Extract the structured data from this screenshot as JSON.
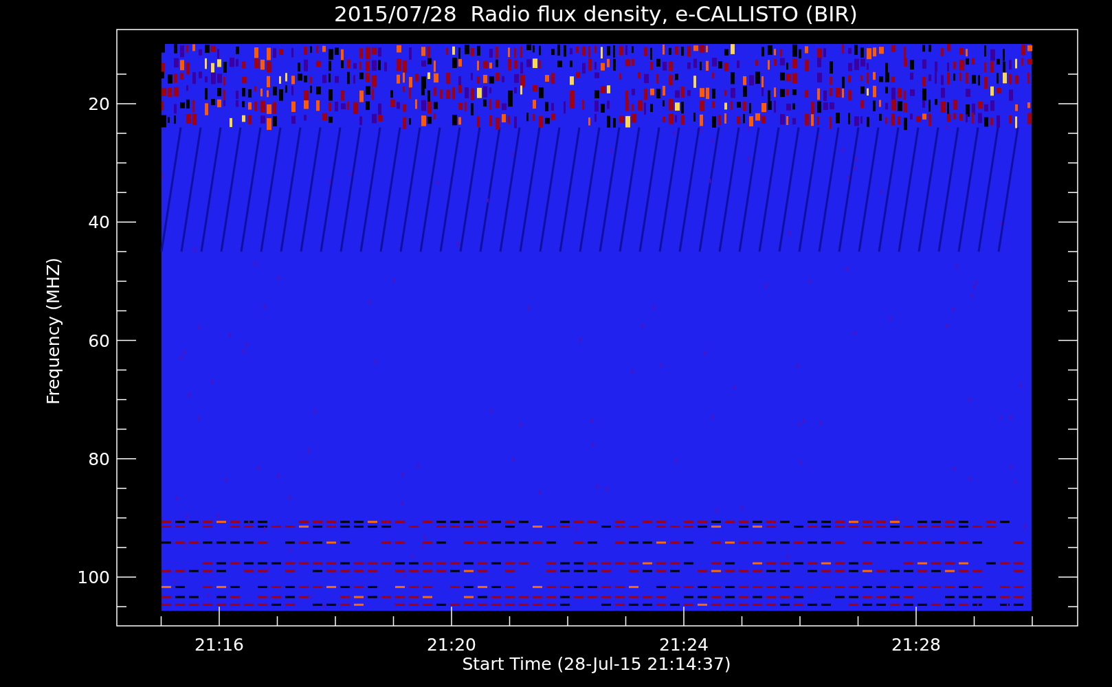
{
  "title": "2015/07/28  Radio flux density, e-CALLISTO (BIR)",
  "y_axis": {
    "label": "Frequency (MHZ)",
    "ticks": [
      "20",
      "40",
      "60",
      "80",
      "100"
    ]
  },
  "x_axis": {
    "label": "Start Time (28-Jul-15 21:14:37)",
    "ticks": [
      "21:16",
      "21:20",
      "21:24",
      "21:28"
    ]
  }
}
